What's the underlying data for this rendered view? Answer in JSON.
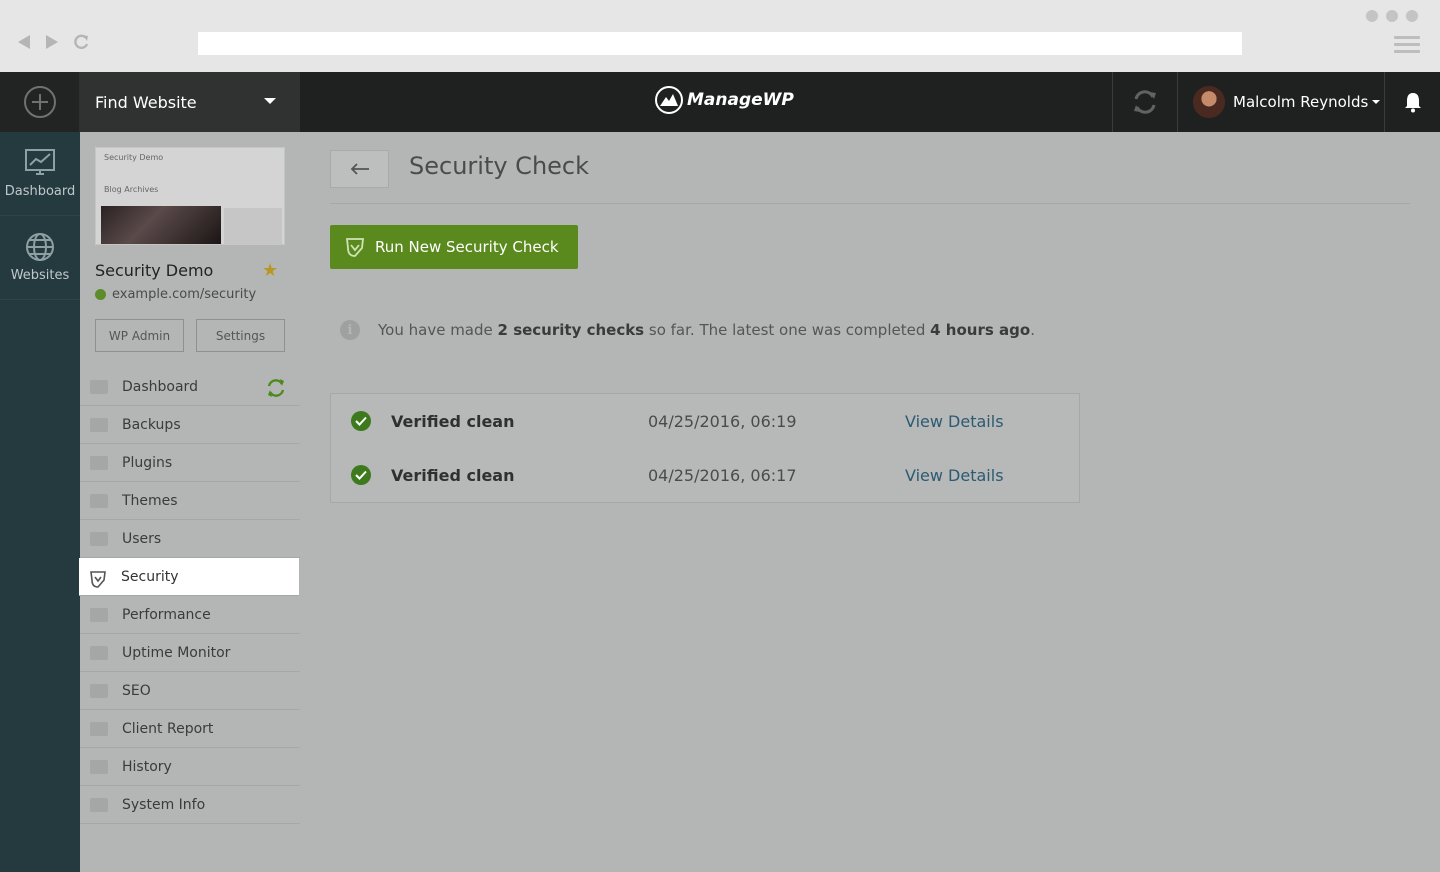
{
  "browser": {
    "url": ""
  },
  "topbar": {
    "find_website": "Find Website",
    "logo_text": "ManageWP",
    "user_name": "Malcolm Reynolds"
  },
  "rail": {
    "items": [
      {
        "label": "Dashboard",
        "icon": "monitor-chart-icon"
      },
      {
        "label": "Websites",
        "icon": "globe-icon"
      }
    ]
  },
  "site": {
    "thumb_title": "Security Demo",
    "thumb_blog": "Blog Archives",
    "name": "Security Demo",
    "url": "example.com/security",
    "wp_admin": "WP Admin",
    "settings": "Settings"
  },
  "menu": {
    "items": [
      {
        "label": "Dashboard",
        "icon": "monitor-icon"
      },
      {
        "label": "Backups",
        "icon": "backup-icon"
      },
      {
        "label": "Plugins",
        "icon": "plug-icon"
      },
      {
        "label": "Themes",
        "icon": "palette-icon"
      },
      {
        "label": "Users",
        "icon": "user-icon"
      },
      {
        "label": "Security",
        "icon": "shield-icon"
      },
      {
        "label": "Performance",
        "icon": "gauge-icon"
      },
      {
        "label": "Uptime Monitor",
        "icon": "arrow-up-icon"
      },
      {
        "label": "SEO",
        "icon": "megaphone-icon"
      },
      {
        "label": "Client Report",
        "icon": "report-chart-icon"
      },
      {
        "label": "History",
        "icon": "clock-icon"
      },
      {
        "label": "System Info",
        "icon": "server-icon"
      }
    ],
    "active": "Security"
  },
  "main": {
    "title": "Security Check",
    "run_button": "Run New Security Check",
    "info": {
      "prefix": "You have made ",
      "count": "2 security checks",
      "middle": " so far. The latest one was completed ",
      "when": "4 hours ago",
      "suffix": "."
    },
    "checks": [
      {
        "status": "Verified clean",
        "date": "04/25/2016, 06:19",
        "link": "View Details"
      },
      {
        "status": "Verified clean",
        "date": "04/25/2016, 06:17",
        "link": "View Details"
      }
    ]
  },
  "colors": {
    "accent_green": "#5a8a1e",
    "link_blue": "#2c5a72",
    "rail_bg": "#253a3e",
    "topbar_bg": "#1f2121"
  }
}
